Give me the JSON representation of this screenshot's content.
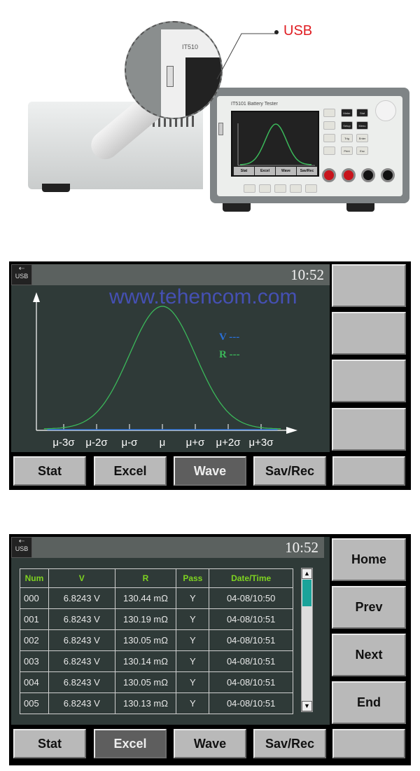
{
  "photo": {
    "callout_label": "USB",
    "device_title": "IT5101 Battery Tester",
    "zoom_label": "IT510",
    "mini_buttons": [
      "Stat",
      "Excel",
      "Wave",
      "Sav/Rec"
    ],
    "keys": [
      "Meter",
      "Stat",
      "Setup",
      "Menu",
      "Trig",
      "Enter",
      "Print",
      "Esc"
    ]
  },
  "wave_screen": {
    "usb_icon": "USB",
    "clock": "10:52",
    "watermark": "www.tehencom.com",
    "legend": [
      {
        "label": "V ---",
        "color": "#2a6fd6"
      },
      {
        "label": "R ---",
        "color": "#3bb85a"
      }
    ],
    "bottom_buttons": [
      "Stat",
      "Excel",
      "Wave",
      "Sav/Rec",
      ""
    ],
    "active": "Wave",
    "side_buttons": [
      "",
      "",
      "",
      ""
    ]
  },
  "chart_data": {
    "type": "line",
    "xticks": [
      "μ-3σ",
      "μ-2σ",
      "μ-σ",
      "μ",
      "μ+σ",
      "μ+2σ",
      "μ+3σ"
    ],
    "series": [
      {
        "name": "V",
        "color": "#2a6fd6",
        "shape": "flat at baseline"
      },
      {
        "name": "R",
        "color": "#3bb85a",
        "shape": "normal distribution curve centered at μ"
      }
    ],
    "xlim_sigma": [
      -3.5,
      3.5
    ],
    "grid": false,
    "legend": "right"
  },
  "excel_screen": {
    "usb_icon": "USB",
    "clock": "10:52",
    "columns": [
      "Num",
      "V",
      "R",
      "Pass",
      "Date/Time"
    ],
    "rows": [
      [
        "000",
        "6.8243 V",
        "130.44 mΩ",
        "Y",
        "04-08/10:50"
      ],
      [
        "001",
        "6.8243 V",
        "130.19 mΩ",
        "Y",
        "04-08/10:51"
      ],
      [
        "002",
        "6.8243 V",
        "130.05 mΩ",
        "Y",
        "04-08/10:51"
      ],
      [
        "003",
        "6.8243 V",
        "130.14 mΩ",
        "Y",
        "04-08/10:51"
      ],
      [
        "004",
        "6.8243 V",
        "130.05 mΩ",
        "Y",
        "04-08/10:51"
      ],
      [
        "005",
        "6.8243 V",
        "130.13 mΩ",
        "Y",
        "04-08/10:51"
      ]
    ],
    "side_buttons": [
      "Home",
      "Prev",
      "Next",
      "End"
    ],
    "bottom_buttons": [
      "Stat",
      "Excel",
      "Wave",
      "Sav/Rec",
      ""
    ],
    "active": "Excel",
    "scroll_position": 0.0
  },
  "colors": {
    "header_text": "#7ed321",
    "scroll_thumb": "#1aa39a",
    "lcd_bg": "#2f3a38"
  }
}
